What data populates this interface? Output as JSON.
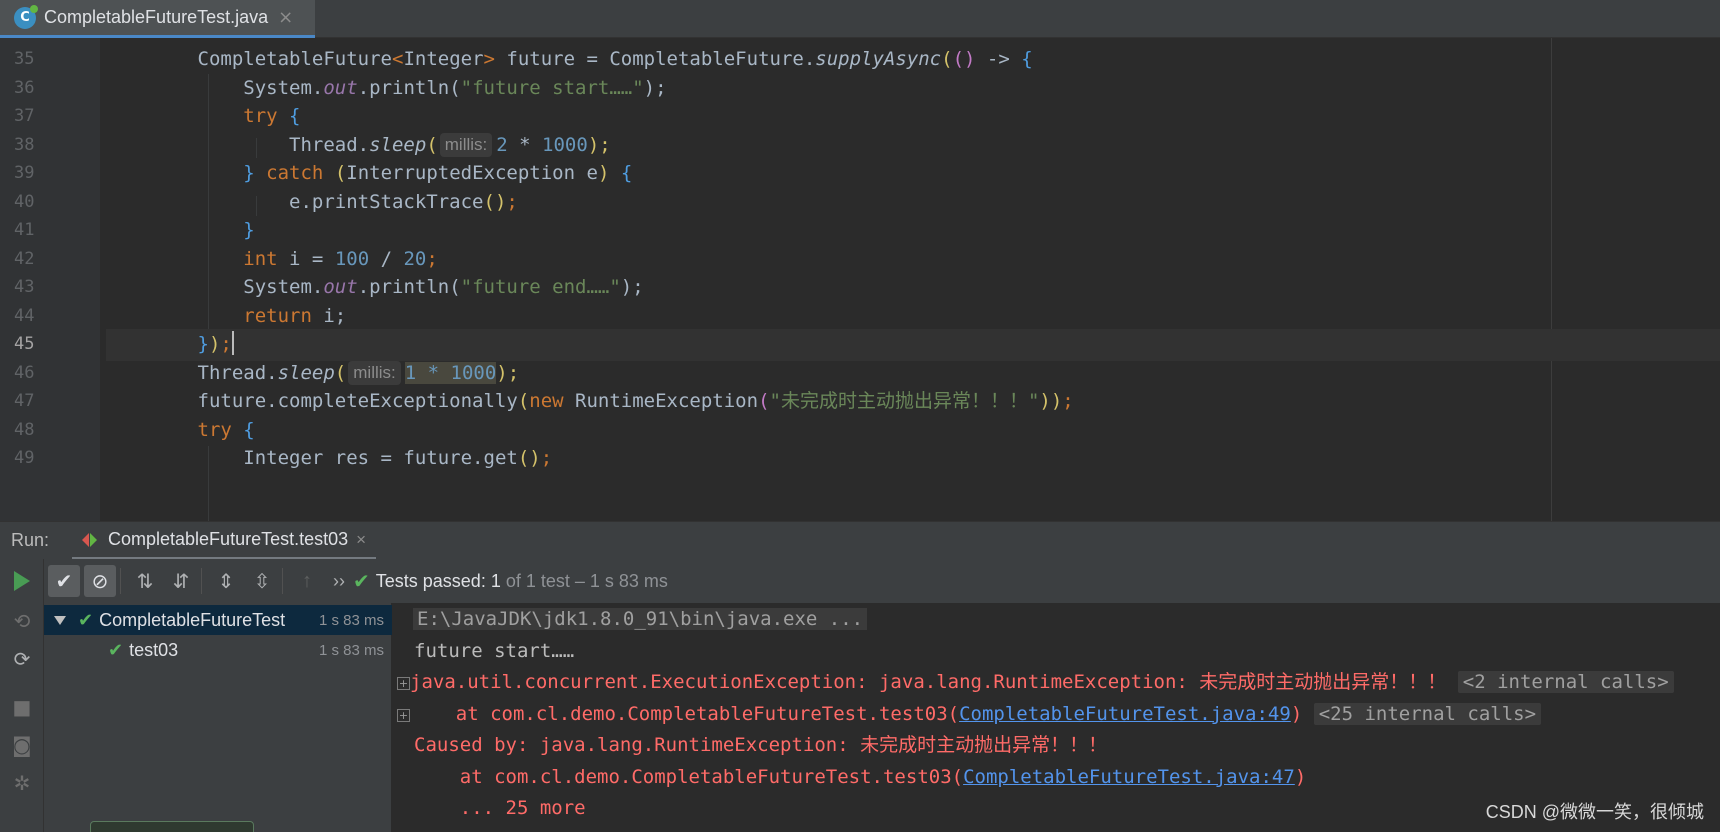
{
  "editor_tab": {
    "file_name": "CompletableFutureTest.java",
    "close": "×"
  },
  "gutter": {
    "line_numbers": [
      "35",
      "36",
      "37",
      "38",
      "39",
      "40",
      "41",
      "42",
      "43",
      "44",
      "45",
      "46",
      "47",
      "48",
      "49"
    ],
    "current_line": "45"
  },
  "code": {
    "l35": {
      "a": "CompletableFuture",
      "b": "<",
      "c": "Integer",
      "d": ">",
      "e": " future = CompletableFuture.",
      "f": "supplyAsync",
      "g": "(",
      "h": "()",
      "i": " -> ",
      "j": "{"
    },
    "l36": {
      "a": "System.",
      "b": "out",
      "c": ".println(",
      "d": "\"future start……\"",
      "e": ");"
    },
    "l37": {
      "a": "try",
      "b": " {"
    },
    "l38": {
      "a": "Thread.",
      "b": "sleep",
      "c": "(",
      "hint": "millis:",
      "d": "2",
      "e": " * ",
      "f": "1000",
      "g": ");"
    },
    "l39": {
      "a": "}",
      "b": " catch",
      "c": " (",
      "d": "InterruptedException e",
      "e": ")",
      "f": " {"
    },
    "l40": {
      "a": "e.printStackTrace",
      "b": "()",
      "c": ";"
    },
    "l41": {
      "a": "}"
    },
    "l42": {
      "a": "int",
      "b": " i = ",
      "c": "100",
      "d": " / ",
      "e": "20",
      "f": ";"
    },
    "l43": {
      "a": "System.",
      "b": "out",
      "c": ".println(",
      "d": "\"future end……\"",
      "e": ");"
    },
    "l44": {
      "a": "return",
      "b": " i;"
    },
    "l45": {
      "a": "}",
      "b": ")",
      "c": ";"
    },
    "l46": {
      "a": "Thread.",
      "b": "sleep",
      "c": "(",
      "hint": "millis:",
      "d": "1 * 1000",
      "e": ");"
    },
    "l47": {
      "a": "future.completeExceptionally",
      "b": "(",
      "c": "new",
      "d": " RuntimeException",
      "e": "(",
      "f": "\"未完成时主动抛出异常！！！\"",
      "g": "))",
      "h": ";"
    },
    "l48": {
      "a": "try",
      "b": " {"
    },
    "l49": {
      "a": "Integer res = future.get",
      "b": "()",
      "c": ";"
    }
  },
  "run_panel": {
    "label": "Run:",
    "tab_name": "CompletableFutureTest.test03",
    "tab_close": "×",
    "status_main": "Tests passed: 1",
    "status_sub": "of 1 test – 1 s 83 ms",
    "chevron": "››"
  },
  "tree": {
    "root": {
      "name": "CompletableFutureTest",
      "time": "1 s 83 ms"
    },
    "child": {
      "name": "test03",
      "time": "1 s 83 ms"
    }
  },
  "console": {
    "cmd": "E:\\JavaJDK\\jdk1.8.0_91\\bin\\java.exe ...",
    "out1": "future start……",
    "err1": "java.util.concurrent.ExecutionException: java.lang.RuntimeException: 未完成时主动抛出异常！！！",
    "internal1": "<2 internal calls>",
    "at1_pre": "    at com.cl.demo.CompletableFutureTest.test03(",
    "at1_link": "CompletableFutureTest.java:49",
    "at1_post": ")",
    "internal2": "<25 internal calls>",
    "caused": "Caused by: java.lang.RuntimeException: 未完成时主动抛出异常！！！",
    "at2_pre": "    at com.cl.demo.CompletableFutureTest.test03(",
    "at2_link": "CompletableFutureTest.java:47",
    "at2_post": ")",
    "more": "    ... 25 more",
    "fold_symbol": "+"
  },
  "watermark": "CSDN @微微一笑，很倾城",
  "icons": {
    "file": "java-class-icon",
    "run": "play-icon",
    "check": "check-icon",
    "cancel": "cancel-icon"
  },
  "colors": {
    "keyword": "#cc7832",
    "number": "#6897bb",
    "string": "#6a8759",
    "error": "#ff6b68",
    "link": "#5394ec",
    "pass": "#5ab55e"
  }
}
